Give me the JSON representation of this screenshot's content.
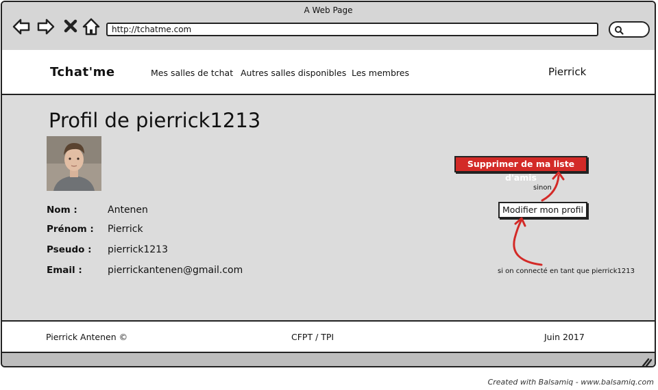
{
  "browser": {
    "window_title": "A Web Page",
    "url": "http://tchatme.com",
    "icons": [
      "back-arrow-icon",
      "forward-arrow-icon",
      "close-x-icon",
      "home-icon",
      "search-icon"
    ]
  },
  "header": {
    "brand": "Tchat'me",
    "nav": [
      {
        "label": "Mes salles de tchat"
      },
      {
        "label": "Autres salles disponibles"
      },
      {
        "label": "Les membres"
      }
    ],
    "user": "Pierrick"
  },
  "profile": {
    "title": "Profil de pierrick1213",
    "fields": [
      {
        "label": "Nom :",
        "value": "Antenen"
      },
      {
        "label": "Prénom :",
        "value": "Pierrick"
      },
      {
        "label": "Pseudo :",
        "value": "pierrick1213"
      },
      {
        "label": "Email :",
        "value": "pierrickantenen@gmail.com"
      }
    ]
  },
  "actions": {
    "remove_friend": "Supprimer de ma liste d'amis",
    "edit_profile": "Modifier mon profil",
    "note_else": "sinon",
    "note_if": "si on connecté en tant que pierrick1213",
    "accent_color": "#d32a27"
  },
  "footer": {
    "left": "Pierrick Antenen ©",
    "center": "CFPT / TPI",
    "right": "Juin 2017"
  },
  "credit": "Created with Balsamiq - www.balsamiq.com"
}
